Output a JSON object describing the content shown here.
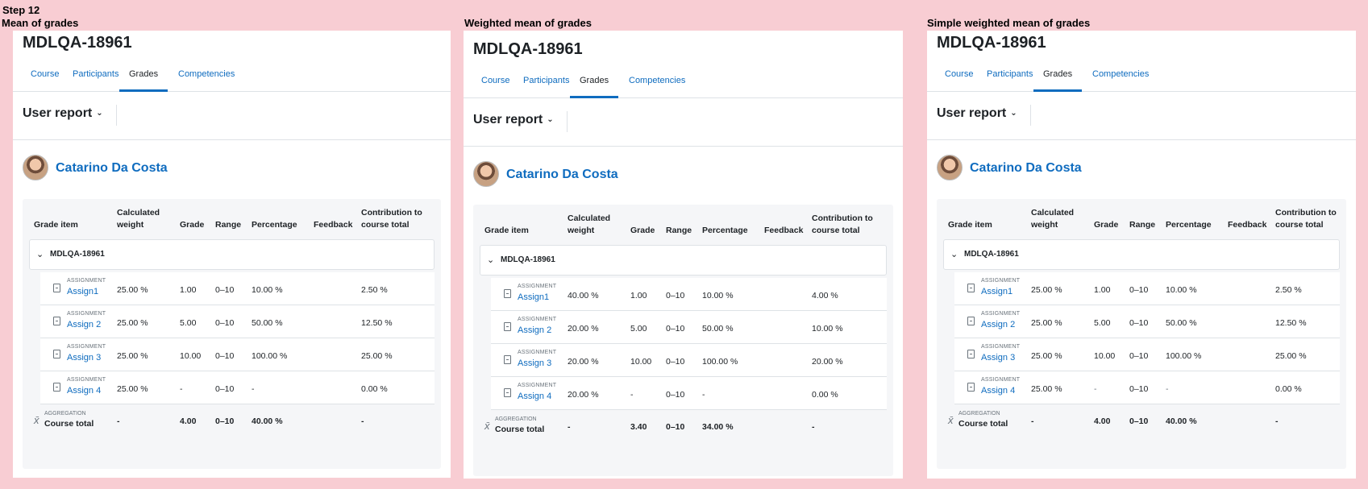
{
  "step_title": "Step 12",
  "panels": [
    {
      "heading": "Mean of grades",
      "course_title": "MDLQA-18961",
      "tabs": [
        {
          "label": "Course"
        },
        {
          "label": "Participants"
        },
        {
          "label": "Grades"
        },
        {
          "label": "Competencies"
        }
      ],
      "active_tab": "Grades",
      "report_select": "User report",
      "user_name": "Catarino Da Costa",
      "columns": {
        "item": "Grade item",
        "weight": "Calculated weight",
        "grade": "Grade",
        "range": "Range",
        "percentage": "Percentage",
        "feedback": "Feedback",
        "contribution": "Contribution to course total"
      },
      "category": "MDLQA-18961",
      "items": [
        {
          "type": "ASSIGNMENT",
          "name": "Assign1",
          "weight": "25.00 %",
          "grade": "1.00",
          "range": "0–10",
          "percentage": "10.00 %",
          "feedback": "",
          "contribution": "2.50 %"
        },
        {
          "type": "ASSIGNMENT",
          "name": "Assign 2",
          "weight": "25.00 %",
          "grade": "5.00",
          "range": "0–10",
          "percentage": "50.00 %",
          "feedback": "",
          "contribution": "12.50 %"
        },
        {
          "type": "ASSIGNMENT",
          "name": "Assign 3",
          "weight": "25.00 %",
          "grade": "10.00",
          "range": "0–10",
          "percentage": "100.00 %",
          "feedback": "",
          "contribution": "25.00 %"
        },
        {
          "type": "ASSIGNMENT",
          "name": "Assign 4",
          "weight": "25.00 %",
          "grade": "-",
          "range": "0–10",
          "percentage": "-",
          "feedback": "",
          "contribution": "0.00 %"
        }
      ],
      "total": {
        "type": "AGGREGATION",
        "name": "Course total",
        "weight": "-",
        "grade": "4.00",
        "range": "0–10",
        "percentage": "40.00 %",
        "feedback": "",
        "contribution": "-"
      }
    },
    {
      "heading": "Weighted mean of grades",
      "course_title": "MDLQA-18961",
      "tabs": [
        {
          "label": "Course"
        },
        {
          "label": "Participants"
        },
        {
          "label": "Grades"
        },
        {
          "label": "Competencies"
        }
      ],
      "active_tab": "Grades",
      "report_select": "User report",
      "user_name": "Catarino Da Costa",
      "columns": {
        "item": "Grade item",
        "weight": "Calculated weight",
        "grade": "Grade",
        "range": "Range",
        "percentage": "Percentage",
        "feedback": "Feedback",
        "contribution": "Contribution to course total"
      },
      "category": "MDLQA-18961",
      "items": [
        {
          "type": "ASSIGNMENT",
          "name": "Assign1",
          "weight": "40.00 %",
          "grade": "1.00",
          "range": "0–10",
          "percentage": "10.00 %",
          "feedback": "",
          "contribution": "4.00 %"
        },
        {
          "type": "ASSIGNMENT",
          "name": "Assign 2",
          "weight": "20.00 %",
          "grade": "5.00",
          "range": "0–10",
          "percentage": "50.00 %",
          "feedback": "",
          "contribution": "10.00 %"
        },
        {
          "type": "ASSIGNMENT",
          "name": "Assign 3",
          "weight": "20.00 %",
          "grade": "10.00",
          "range": "0–10",
          "percentage": "100.00 %",
          "feedback": "",
          "contribution": "20.00 %"
        },
        {
          "type": "ASSIGNMENT",
          "name": "Assign 4",
          "weight": "20.00 %",
          "grade": "-",
          "range": "0–10",
          "percentage": "-",
          "feedback": "",
          "contribution": "0.00 %"
        }
      ],
      "total": {
        "type": "AGGREGATION",
        "name": "Course total",
        "weight": "-",
        "grade": "3.40",
        "range": "0–10",
        "percentage": "34.00 %",
        "feedback": "",
        "contribution": "-"
      }
    },
    {
      "heading": "Simple weighted mean of grades",
      "course_title": "MDLQA-18961",
      "tabs": [
        {
          "label": "Course"
        },
        {
          "label": "Participants"
        },
        {
          "label": "Grades"
        },
        {
          "label": "Competencies"
        }
      ],
      "active_tab": "Grades",
      "report_select": "User report",
      "user_name": "Catarino Da Costa",
      "columns": {
        "item": "Grade item",
        "weight": "Calculated weight",
        "grade": "Grade",
        "range": "Range",
        "percentage": "Percentage",
        "feedback": "Feedback",
        "contribution": "Contribution to course total"
      },
      "category": "MDLQA-18961",
      "items": [
        {
          "type": "ASSIGNMENT",
          "name": "Assign1",
          "weight": "25.00 %",
          "grade": "1.00",
          "range": "0–10",
          "percentage": "10.00 %",
          "feedback": "",
          "contribution": "2.50 %"
        },
        {
          "type": "ASSIGNMENT",
          "name": "Assign 2",
          "weight": "25.00 %",
          "grade": "5.00",
          "range": "0–10",
          "percentage": "50.00 %",
          "feedback": "",
          "contribution": "12.50 %"
        },
        {
          "type": "ASSIGNMENT",
          "name": "Assign 3",
          "weight": "25.00 %",
          "grade": "10.00",
          "range": "0–10",
          "percentage": "100.00 %",
          "feedback": "",
          "contribution": "25.00 %"
        },
        {
          "type": "ASSIGNMENT",
          "name": "Assign 4",
          "weight": "25.00 %",
          "grade": "-",
          "range": "0–10",
          "percentage": "-",
          "feedback": "",
          "contribution": "0.00 %"
        }
      ],
      "total": {
        "type": "AGGREGATION",
        "name": "Course total",
        "weight": "-",
        "grade": "4.00",
        "range": "0–10",
        "percentage": "40.00 %",
        "feedback": "",
        "contribution": "-"
      }
    }
  ]
}
